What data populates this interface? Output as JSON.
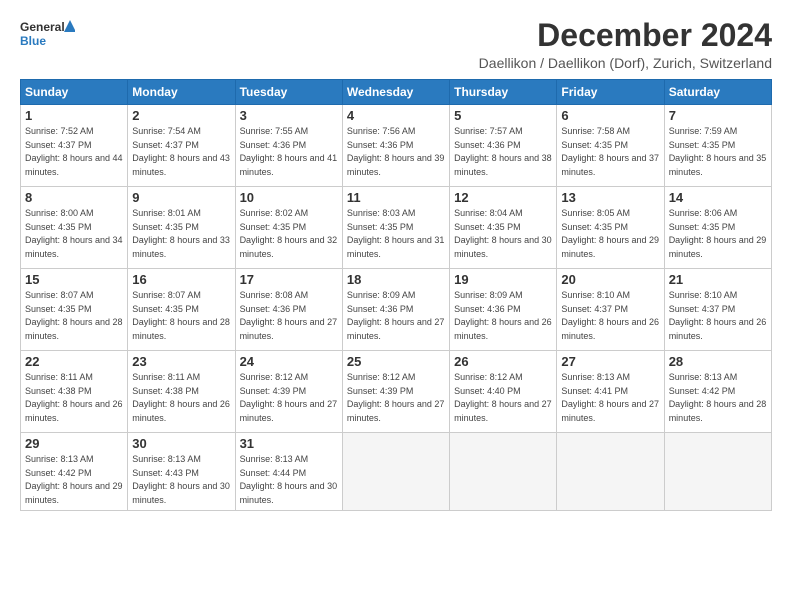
{
  "logo": {
    "general": "General",
    "blue": "Blue"
  },
  "header": {
    "month_year": "December 2024",
    "location": "Daellikon / Daellikon (Dorf), Zurich, Switzerland"
  },
  "weekdays": [
    "Sunday",
    "Monday",
    "Tuesday",
    "Wednesday",
    "Thursday",
    "Friday",
    "Saturday"
  ],
  "weeks": [
    [
      {
        "day": "1",
        "sunrise": "7:52 AM",
        "sunset": "4:37 PM",
        "daylight": "8 hours and 44 minutes."
      },
      {
        "day": "2",
        "sunrise": "7:54 AM",
        "sunset": "4:37 PM",
        "daylight": "8 hours and 43 minutes."
      },
      {
        "day": "3",
        "sunrise": "7:55 AM",
        "sunset": "4:36 PM",
        "daylight": "8 hours and 41 minutes."
      },
      {
        "day": "4",
        "sunrise": "7:56 AM",
        "sunset": "4:36 PM",
        "daylight": "8 hours and 39 minutes."
      },
      {
        "day": "5",
        "sunrise": "7:57 AM",
        "sunset": "4:36 PM",
        "daylight": "8 hours and 38 minutes."
      },
      {
        "day": "6",
        "sunrise": "7:58 AM",
        "sunset": "4:35 PM",
        "daylight": "8 hours and 37 minutes."
      },
      {
        "day": "7",
        "sunrise": "7:59 AM",
        "sunset": "4:35 PM",
        "daylight": "8 hours and 35 minutes."
      }
    ],
    [
      {
        "day": "8",
        "sunrise": "8:00 AM",
        "sunset": "4:35 PM",
        "daylight": "8 hours and 34 minutes."
      },
      {
        "day": "9",
        "sunrise": "8:01 AM",
        "sunset": "4:35 PM",
        "daylight": "8 hours and 33 minutes."
      },
      {
        "day": "10",
        "sunrise": "8:02 AM",
        "sunset": "4:35 PM",
        "daylight": "8 hours and 32 minutes."
      },
      {
        "day": "11",
        "sunrise": "8:03 AM",
        "sunset": "4:35 PM",
        "daylight": "8 hours and 31 minutes."
      },
      {
        "day": "12",
        "sunrise": "8:04 AM",
        "sunset": "4:35 PM",
        "daylight": "8 hours and 30 minutes."
      },
      {
        "day": "13",
        "sunrise": "8:05 AM",
        "sunset": "4:35 PM",
        "daylight": "8 hours and 29 minutes."
      },
      {
        "day": "14",
        "sunrise": "8:06 AM",
        "sunset": "4:35 PM",
        "daylight": "8 hours and 29 minutes."
      }
    ],
    [
      {
        "day": "15",
        "sunrise": "8:07 AM",
        "sunset": "4:35 PM",
        "daylight": "8 hours and 28 minutes."
      },
      {
        "day": "16",
        "sunrise": "8:07 AM",
        "sunset": "4:35 PM",
        "daylight": "8 hours and 28 minutes."
      },
      {
        "day": "17",
        "sunrise": "8:08 AM",
        "sunset": "4:36 PM",
        "daylight": "8 hours and 27 minutes."
      },
      {
        "day": "18",
        "sunrise": "8:09 AM",
        "sunset": "4:36 PM",
        "daylight": "8 hours and 27 minutes."
      },
      {
        "day": "19",
        "sunrise": "8:09 AM",
        "sunset": "4:36 PM",
        "daylight": "8 hours and 26 minutes."
      },
      {
        "day": "20",
        "sunrise": "8:10 AM",
        "sunset": "4:37 PM",
        "daylight": "8 hours and 26 minutes."
      },
      {
        "day": "21",
        "sunrise": "8:10 AM",
        "sunset": "4:37 PM",
        "daylight": "8 hours and 26 minutes."
      }
    ],
    [
      {
        "day": "22",
        "sunrise": "8:11 AM",
        "sunset": "4:38 PM",
        "daylight": "8 hours and 26 minutes."
      },
      {
        "day": "23",
        "sunrise": "8:11 AM",
        "sunset": "4:38 PM",
        "daylight": "8 hours and 26 minutes."
      },
      {
        "day": "24",
        "sunrise": "8:12 AM",
        "sunset": "4:39 PM",
        "daylight": "8 hours and 27 minutes."
      },
      {
        "day": "25",
        "sunrise": "8:12 AM",
        "sunset": "4:39 PM",
        "daylight": "8 hours and 27 minutes."
      },
      {
        "day": "26",
        "sunrise": "8:12 AM",
        "sunset": "4:40 PM",
        "daylight": "8 hours and 27 minutes."
      },
      {
        "day": "27",
        "sunrise": "8:13 AM",
        "sunset": "4:41 PM",
        "daylight": "8 hours and 27 minutes."
      },
      {
        "day": "28",
        "sunrise": "8:13 AM",
        "sunset": "4:42 PM",
        "daylight": "8 hours and 28 minutes."
      }
    ],
    [
      {
        "day": "29",
        "sunrise": "8:13 AM",
        "sunset": "4:42 PM",
        "daylight": "8 hours and 29 minutes."
      },
      {
        "day": "30",
        "sunrise": "8:13 AM",
        "sunset": "4:43 PM",
        "daylight": "8 hours and 30 minutes."
      },
      {
        "day": "31",
        "sunrise": "8:13 AM",
        "sunset": "4:44 PM",
        "daylight": "8 hours and 30 minutes."
      },
      null,
      null,
      null,
      null
    ]
  ]
}
